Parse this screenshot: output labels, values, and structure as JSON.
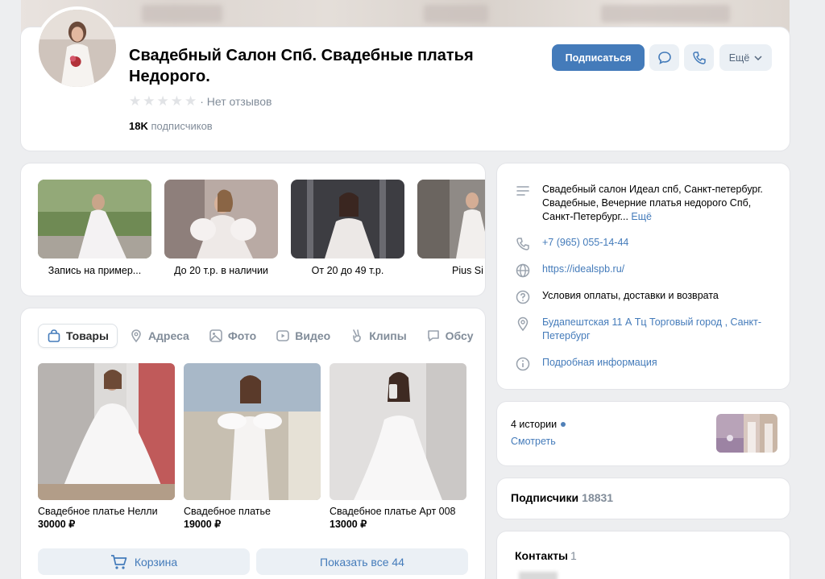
{
  "group": {
    "title": "Свадебный Салон Спб. Свадебные платья Недорого.",
    "rating_text": "· Нет отзывов",
    "subscribers_count": "18K",
    "subscribers_label": "подписчиков"
  },
  "actions": {
    "subscribe_label": "Подписаться",
    "more_label": "Ещё"
  },
  "albums": [
    {
      "label": "Запись на пример..."
    },
    {
      "label": "До 20 т.р. в наличии"
    },
    {
      "label": "От 20 до 49 т.р."
    },
    {
      "label": "Pius Si"
    }
  ],
  "tabs": [
    {
      "label": "Товары",
      "icon": "bag-icon",
      "active": true
    },
    {
      "label": "Адреса",
      "icon": "pin-icon"
    },
    {
      "label": "Фото",
      "icon": "photo-icon"
    },
    {
      "label": "Видео",
      "icon": "video-icon"
    },
    {
      "label": "Клипы",
      "icon": "clips-icon"
    },
    {
      "label": "Обсу",
      "icon": "comments-icon"
    }
  ],
  "products": [
    {
      "name": "Свадебное платье Нелли",
      "price": "30000 ₽"
    },
    {
      "name": "Свадебное платье",
      "price": "19000 ₽"
    },
    {
      "name": "Свадебное платье Арт 008",
      "price": "13000 ₽"
    }
  ],
  "goods_buttons": {
    "cart_label": "Корзина",
    "show_all_label": "Показать все 44"
  },
  "info": {
    "description": "Свадебный салон Идеал спб, Санкт-петербург. Свадебные, Вечерние платья недорого Спб, Санкт-Петербург...",
    "description_more": "Ещё",
    "phone": "+7 (965) 055-14-44",
    "website": "https://idealspb.ru/",
    "payment_terms": "Условия оплаты, доставки и возврата",
    "address": "Будапештская 11 А Тц Торговый город , Санкт-Петербург",
    "details": "Подробная информация"
  },
  "stories": {
    "title": "4 истории",
    "watch": "Смотреть"
  },
  "subscribers": {
    "title": "Подписчики",
    "count": "18831"
  },
  "contacts": {
    "title": "Контакты",
    "count": "1"
  },
  "colors": {
    "accent": "#447bba",
    "link": "#447bba",
    "secondary_button": "#ebf0f5",
    "page_bg": "#edeef0"
  }
}
